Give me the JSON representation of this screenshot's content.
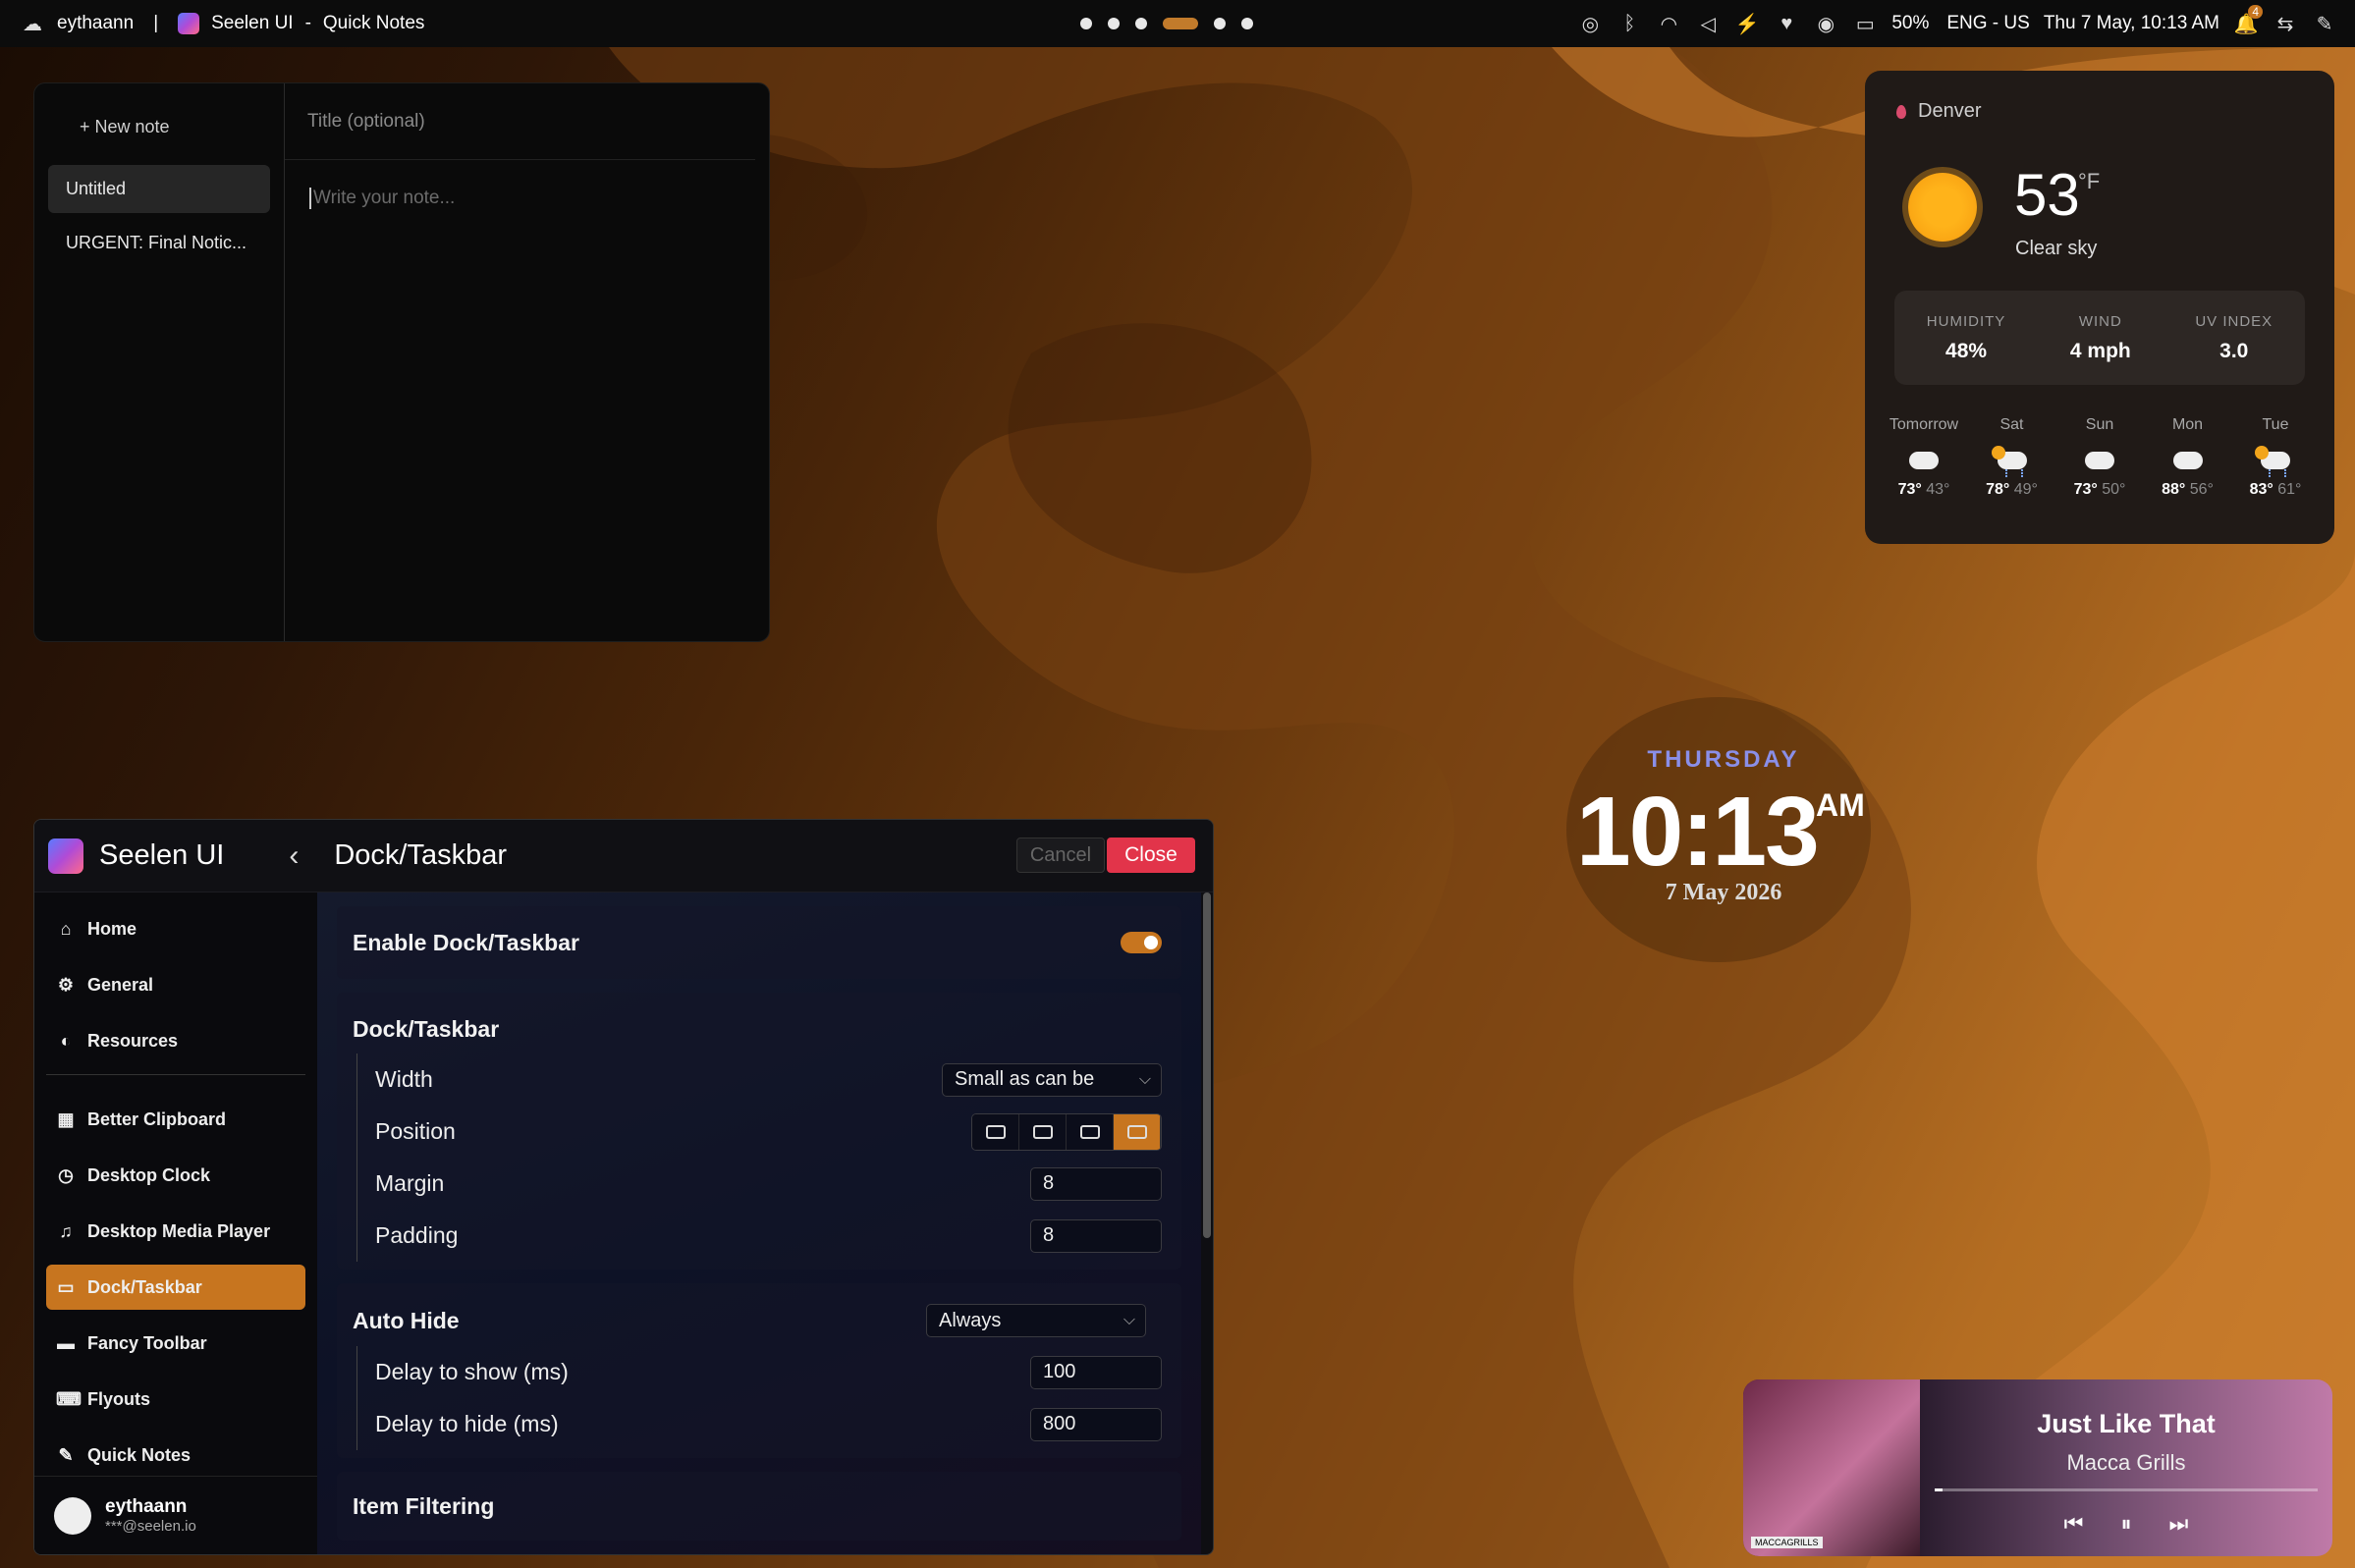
{
  "topbar": {
    "user": "eythaann",
    "separator": "|",
    "app_name": "Seelen UI",
    "dash": "-",
    "window_title": "Quick Notes",
    "battery": "50%",
    "language": "ENG - US",
    "datetime": "Thu 7 May, 10:13 AM",
    "notification_count": "4",
    "icons": [
      "check-circle-icon",
      "bluetooth-icon",
      "wifi-icon",
      "volume-icon",
      "power-icon",
      "heart-icon",
      "gamepad-icon",
      "battery-icon",
      "bell-icon",
      "settings-toggle-icon",
      "edit-icon"
    ]
  },
  "workspaces": {
    "count": 6,
    "active_index": 3
  },
  "quick_notes": {
    "new_note": "+ New note",
    "title_placeholder": "Title (optional)",
    "body_placeholder": "Write your note...",
    "notes": [
      "Untitled",
      "URGENT: Final Notic..."
    ]
  },
  "weather": {
    "city": "Denver",
    "temperature": "53",
    "unit": "°F",
    "condition": "Clear sky",
    "stats": [
      {
        "label": "HUMIDITY",
        "value": "48%"
      },
      {
        "label": "WIND",
        "value": "4 mph"
      },
      {
        "label": "UV INDEX",
        "value": "3.0"
      }
    ],
    "forecast": [
      {
        "day": "Tomorrow",
        "icon": "cloud-icon",
        "high": "73°",
        "low": "43°"
      },
      {
        "day": "Sat",
        "icon": "sun-rain-icon",
        "high": "78°",
        "low": "49°"
      },
      {
        "day": "Sun",
        "icon": "cloud-icon",
        "high": "73°",
        "low": "50°"
      },
      {
        "day": "Mon",
        "icon": "cloud-icon",
        "high": "88°",
        "low": "56°"
      },
      {
        "day": "Tue",
        "icon": "sun-rain-icon",
        "high": "83°",
        "low": "61°"
      }
    ]
  },
  "clock": {
    "weekday": "THURSDAY",
    "time": "10:13",
    "ampm": "AM",
    "date": "7 May 2026"
  },
  "media": {
    "title": "Just Like That",
    "artist": "Macca Grills",
    "progress": 0.02,
    "cover_label": "MACCAGRILLS"
  },
  "settings": {
    "app_name": "Seelen UI",
    "page_title": "Dock/Taskbar",
    "cancel_label": "Cancel",
    "close_label": "Close",
    "nav_top": [
      {
        "label": "Home",
        "icon": "home-icon"
      },
      {
        "label": "General",
        "icon": "gear-icon"
      },
      {
        "label": "Resources",
        "icon": "palette-icon"
      }
    ],
    "nav_widgets": [
      {
        "label": "Better Clipboard",
        "icon": "grid-icon"
      },
      {
        "label": "Desktop Clock",
        "icon": "clock-icon"
      },
      {
        "label": "Desktop Media Player",
        "icon": "media-icon"
      },
      {
        "label": "Dock/Taskbar",
        "icon": "dock-icon",
        "active": true
      },
      {
        "label": "Fancy Toolbar",
        "icon": "toolbar-icon"
      },
      {
        "label": "Flyouts",
        "icon": "flyout-icon"
      },
      {
        "label": "Quick Notes",
        "icon": "note-icon"
      }
    ],
    "user": {
      "name": "eythaann",
      "email": "***@seelen.io"
    },
    "enable_label": "Enable Dock/Taskbar",
    "enabled": true,
    "section_title": "Dock/Taskbar",
    "width_label": "Width",
    "width_value": "Small as can be",
    "position_label": "Position",
    "position_selected": "bottom",
    "margin_label": "Margin",
    "margin_value": "8",
    "padding_label": "Padding",
    "padding_value": "8",
    "autohide_label": "Auto Hide",
    "autohide_value": "Always",
    "delay_show_label": "Delay to show (ms)",
    "delay_show_value": "100",
    "delay_hide_label": "Delay to hide (ms)",
    "delay_hide_value": "800",
    "item_filtering_label": "Item Filtering"
  }
}
